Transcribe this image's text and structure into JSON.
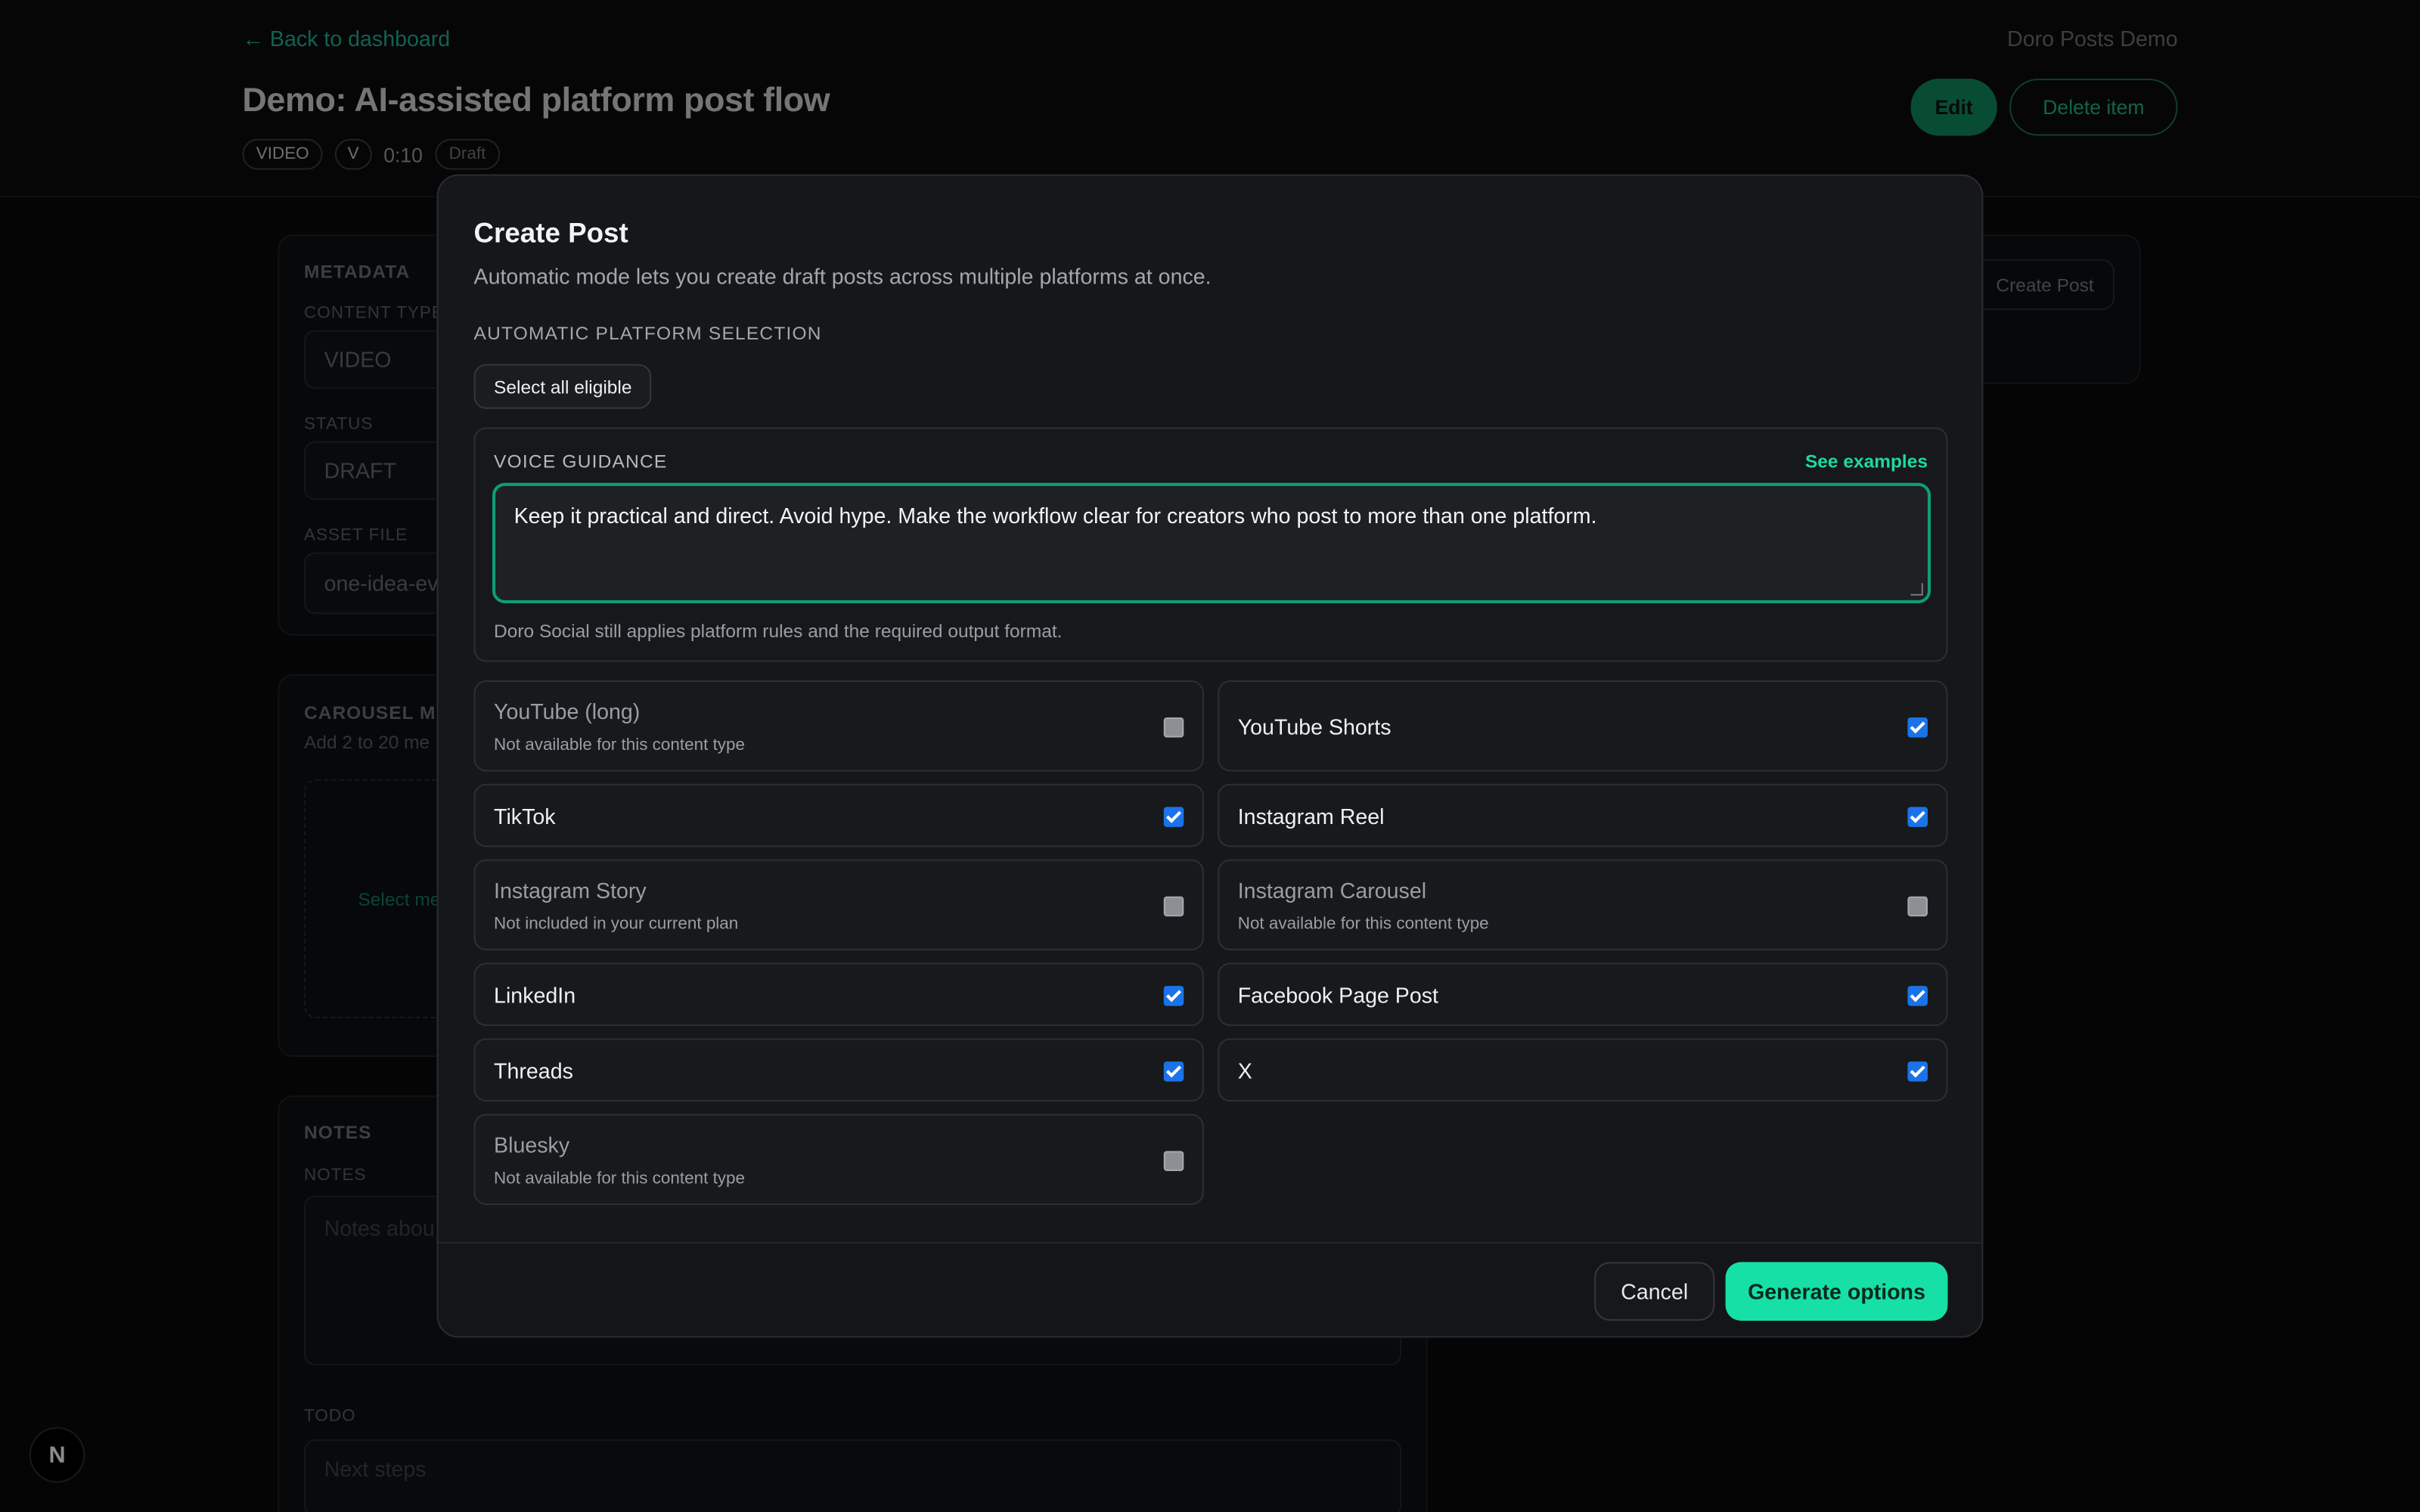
{
  "page": {
    "back_link": "← Back to dashboard",
    "brand": "Doro Posts Demo",
    "title": "Demo: AI-assisted platform post flow",
    "meta": {
      "type_pill": "VIDEO",
      "variant_pill": "V",
      "duration": "0:10",
      "status_pill": "Draft"
    },
    "edit_label": "Edit",
    "delete_label": "Delete item",
    "create_post_label": "Create Post",
    "metadata_card": {
      "label": "METADATA",
      "content_type_label": "CONTENT TYPE",
      "content_type_value": "VIDEO",
      "status_label": "STATUS",
      "status_value": "DRAFT",
      "asset_label": "ASSET FILE",
      "asset_value": "one-idea-ev"
    },
    "carousel_card": {
      "label": "CAROUSEL ME",
      "sub": "Add 2 to 20 me",
      "select_media": "Select me"
    },
    "notes_card": {
      "label": "NOTES",
      "notes_label": "NOTES",
      "notes_placeholder": "Notes abou",
      "todo_label": "TODO",
      "todo_placeholder": "Next steps"
    },
    "badge": "N"
  },
  "modal": {
    "title": "Create Post",
    "description": "Automatic mode lets you create draft posts across multiple platforms at once.",
    "section_label": "AUTOMATIC PLATFORM SELECTION",
    "select_all_label": "Select all eligible",
    "voice": {
      "label": "VOICE GUIDANCE",
      "see_examples": "See examples",
      "text": "Keep it practical and direct. Avoid hype. Make the workflow clear for creators who post to more than one platform.",
      "help": "Doro Social still applies platform rules and the required output format."
    },
    "platforms": [
      {
        "name": "YouTube (long)",
        "sub": "Not available for this content type",
        "checked": false
      },
      {
        "name": "YouTube Shorts",
        "sub": "",
        "checked": true
      },
      {
        "name": "TikTok",
        "sub": "",
        "checked": true
      },
      {
        "name": "Instagram Reel",
        "sub": "",
        "checked": true
      },
      {
        "name": "Instagram Story",
        "sub": "Not included in your current plan",
        "checked": false
      },
      {
        "name": "Instagram Carousel",
        "sub": "Not available for this content type",
        "checked": false
      },
      {
        "name": "LinkedIn",
        "sub": "",
        "checked": true
      },
      {
        "name": "Facebook Page Post",
        "sub": "",
        "checked": true
      },
      {
        "name": "Threads",
        "sub": "",
        "checked": true
      },
      {
        "name": "X",
        "sub": "",
        "checked": true
      },
      {
        "name": "Bluesky",
        "sub": "Not available for this content type",
        "checked": false
      }
    ],
    "cancel_label": "Cancel",
    "generate_label": "Generate options"
  }
}
